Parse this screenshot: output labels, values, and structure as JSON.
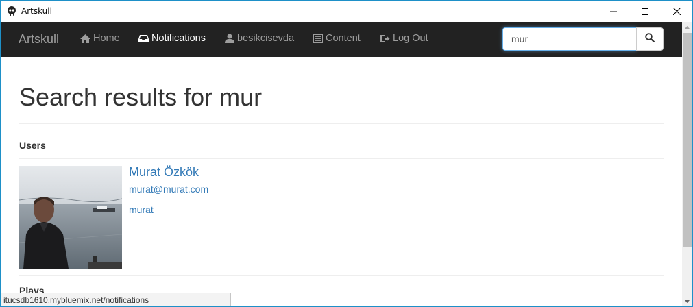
{
  "window": {
    "title": "Artskull",
    "icon": "skull-icon"
  },
  "navbar": {
    "brand": "Artskull",
    "items": [
      {
        "label": "Home",
        "icon": "home-icon"
      },
      {
        "label": "Notifications",
        "icon": "inbox-icon",
        "active": true
      },
      {
        "label": "besikcisevda",
        "icon": "user-icon"
      },
      {
        "label": "Content",
        "icon": "list-icon"
      },
      {
        "label": "Log Out",
        "icon": "logout-icon"
      }
    ],
    "search": {
      "value": "mur",
      "button_icon": "search-icon"
    }
  },
  "main": {
    "title": "Search results for mur",
    "sections": {
      "users_label": "Users",
      "plays_label": "Plays"
    },
    "users": [
      {
        "name": "Murat Özkök",
        "email": "murat@murat.com",
        "username": "murat"
      }
    ]
  },
  "statusbar": {
    "url": "itucsdb1610.mybluemix.net/notifications"
  },
  "colors": {
    "navbar_bg": "#222222",
    "nav_text": "#9d9d9d",
    "nav_active": "#ffffff",
    "link": "#337ab7",
    "window_border": "#1e90c8"
  }
}
